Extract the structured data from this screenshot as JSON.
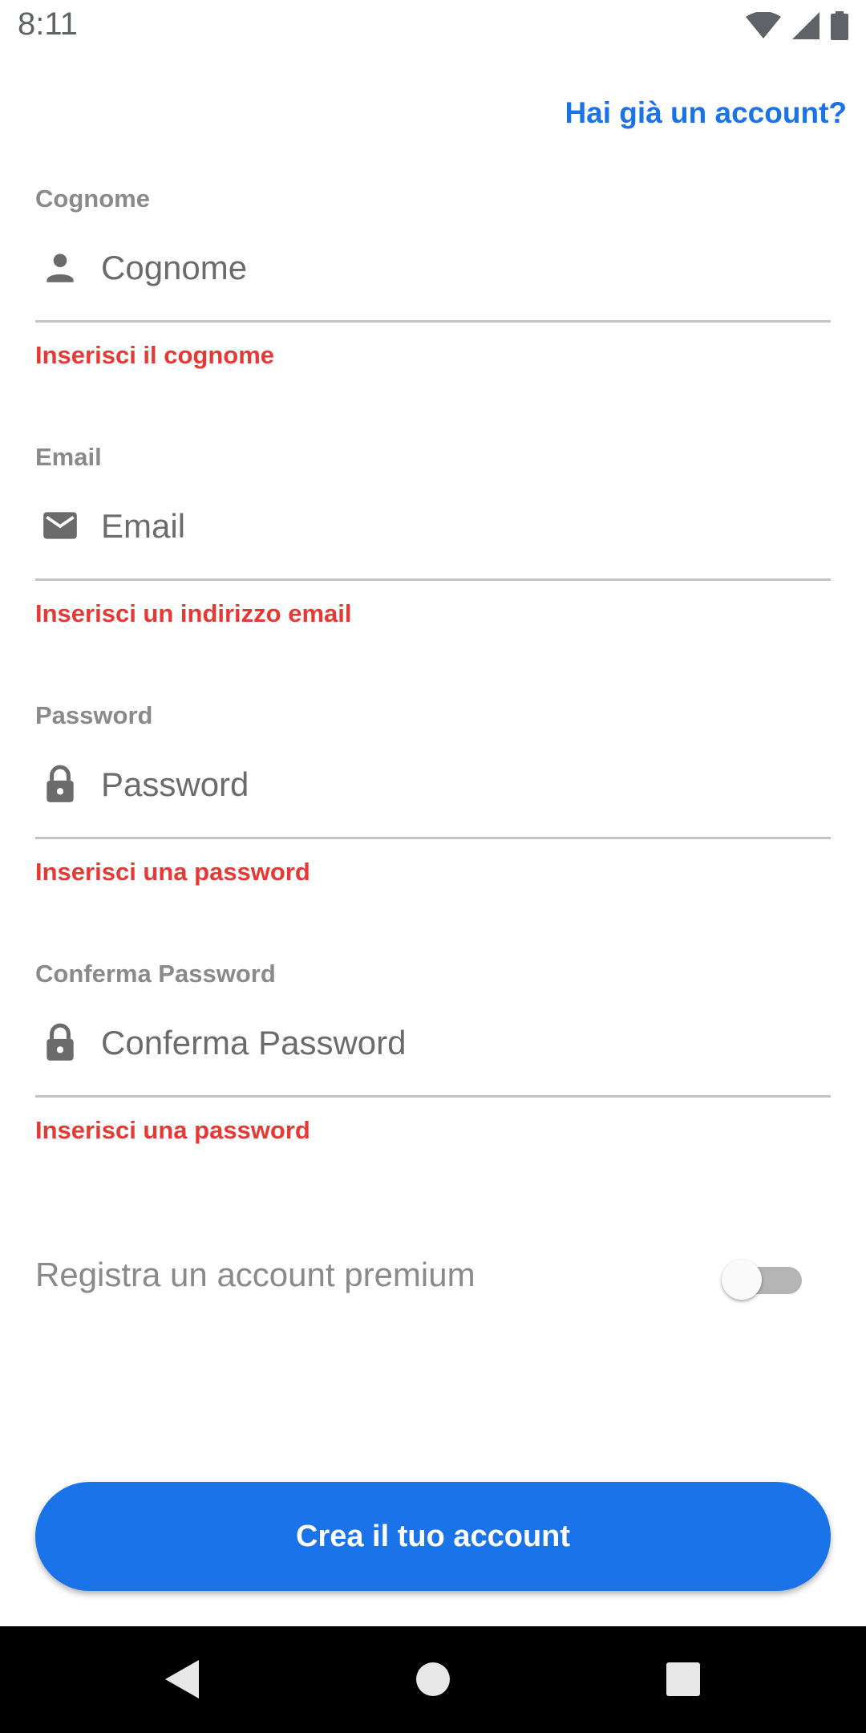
{
  "status_bar": {
    "time": "8:11",
    "icons": [
      "wifi-icon",
      "cellular-signal-icon",
      "battery-icon"
    ]
  },
  "header": {
    "login_link": "Hai già un account?"
  },
  "form": {
    "fields": [
      {
        "label": "Cognome",
        "placeholder": "Cognome",
        "value": "",
        "icon": "person-icon",
        "error": "Inserisci il cognome"
      },
      {
        "label": "Email",
        "placeholder": "Email",
        "value": "",
        "icon": "mail-icon",
        "error": "Inserisci un indirizzo email"
      },
      {
        "label": "Password",
        "placeholder": "Password",
        "value": "",
        "icon": "lock-icon",
        "error": "Inserisci una password"
      },
      {
        "label": "Conferma Password",
        "placeholder": "Conferma Password",
        "value": "",
        "icon": "lock-icon",
        "error": "Inserisci una password"
      }
    ],
    "premium_toggle": {
      "label": "Registra un account premium",
      "on": false
    },
    "submit_label": "Crea il tuo account"
  },
  "nav_bar": {
    "icons": [
      "back-icon",
      "home-icon",
      "recents-icon"
    ]
  },
  "colors": {
    "accent": "#1a73e8",
    "error": "#e53935",
    "label": "#8a8a8a",
    "navbar": "#000000"
  }
}
